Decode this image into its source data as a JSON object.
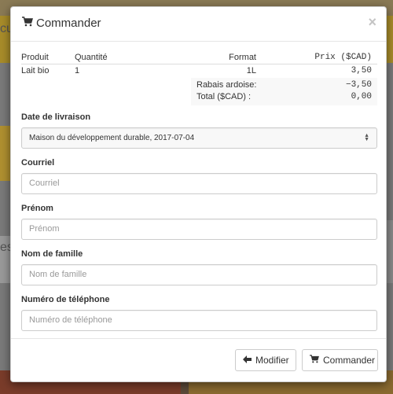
{
  "background": {
    "text_left_top": "cu",
    "text_left_mid": "es"
  },
  "modal": {
    "title": "Commander",
    "close_symbol": "×",
    "title_icon": "shopping-cart-icon"
  },
  "order_table": {
    "headers": [
      "Produit",
      "Quantité",
      "Format",
      "Prix ($CAD)"
    ],
    "rows": [
      {
        "product": "Lait bio",
        "quantity": "1",
        "format": "1L",
        "price": "3,50"
      }
    ]
  },
  "totals": {
    "discount_label": "Rabais ardoise:",
    "discount_value": "−3,50",
    "total_label": "Total ($CAD) :",
    "total_value": "0,00"
  },
  "form": {
    "delivery": {
      "label": "Date de livraison",
      "selected": "Maison du développement durable, 2017-07-04"
    },
    "email": {
      "label": "Courriel",
      "placeholder": "Courriel"
    },
    "first_name": {
      "label": "Prénom",
      "placeholder": "Prénom"
    },
    "last_name": {
      "label": "Nom de famille",
      "placeholder": "Nom de famille"
    },
    "phone": {
      "label": "Numéro de téléphone",
      "placeholder": "Numéro de téléphone"
    }
  },
  "footer": {
    "back_label": "Modifier",
    "order_label": "Commander",
    "back_icon": "arrow-left-icon",
    "order_icon": "shopping-cart-icon"
  }
}
